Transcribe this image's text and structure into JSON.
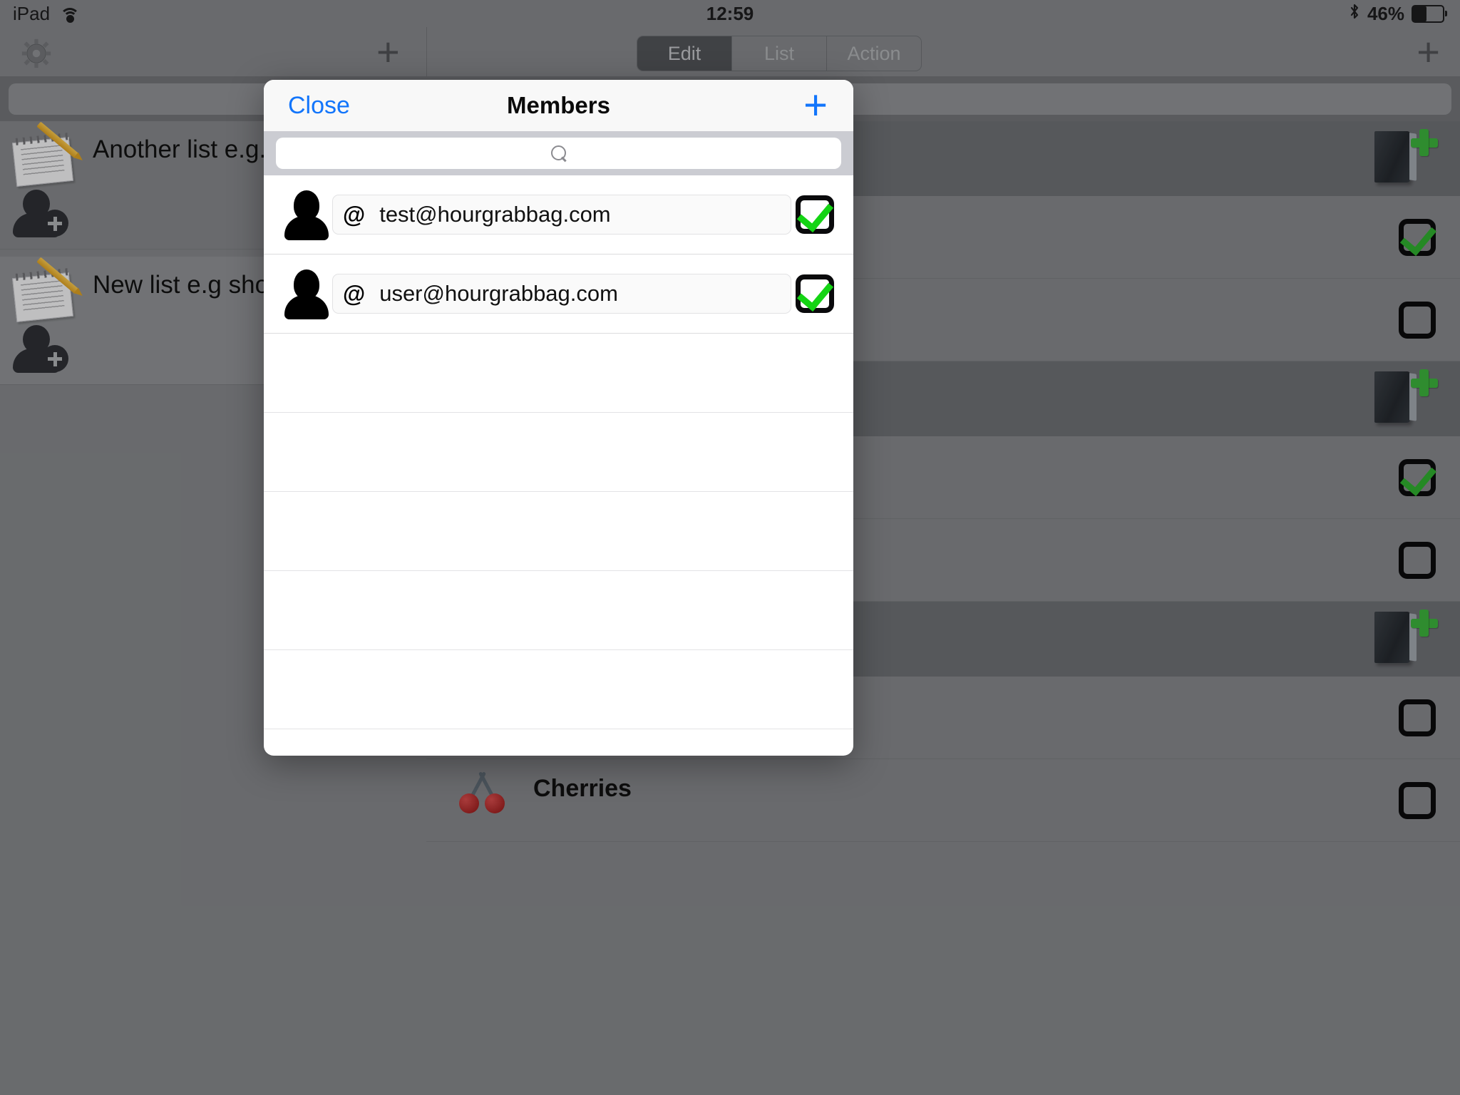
{
  "status_bar": {
    "device": "iPad",
    "wifi_icon": "wifi-icon",
    "time": "12:59",
    "bluetooth_icon": "bluetooth-icon",
    "battery_percent": "46%",
    "battery_level": 46
  },
  "left_pane": {
    "settings_icon": "gear-icon",
    "add_icon": "plus-icon",
    "search_placeholder": "",
    "search_value": "",
    "lists": [
      {
        "title": "Another list e.g. Work",
        "icon": "notepad-pencil-icon",
        "member_icon": "person-add-icon"
      },
      {
        "title": "New list e.g shopping list",
        "icon": "notepad-pencil-icon",
        "member_icon": "person-add-icon"
      }
    ]
  },
  "right_pane": {
    "segmented": {
      "options": [
        "Edit",
        "List",
        "Action"
      ],
      "selected": "Edit"
    },
    "add_icon": "plus-icon",
    "rows": [
      {
        "type": "book",
        "icon": "book-add-icon"
      },
      {
        "type": "check",
        "icon": "checkbox-checked-icon",
        "checked": true
      },
      {
        "type": "check",
        "icon": "checkbox-unchecked-icon",
        "checked": false
      },
      {
        "type": "book",
        "icon": "book-add-icon"
      },
      {
        "type": "check",
        "icon": "checkbox-checked-icon",
        "checked": true
      },
      {
        "type": "check",
        "icon": "checkbox-unchecked-icon",
        "checked": false
      },
      {
        "type": "book",
        "icon": "book-add-icon"
      },
      {
        "type": "check",
        "icon": "checkbox-unchecked-icon",
        "checked": false
      }
    ],
    "bottom_item": {
      "title": "Cherries",
      "icon": "cherries-icon"
    }
  },
  "modal": {
    "close_label": "Close",
    "title": "Members",
    "add_icon": "plus-icon",
    "search_value": "",
    "search_placeholder": "",
    "search_icon": "search-icon",
    "members": [
      {
        "avatar": "person-icon",
        "at_symbol": "@",
        "email": "test@hourgrabbag.com",
        "checked": true
      },
      {
        "avatar": "person-icon",
        "at_symbol": "@",
        "email": "user@hourgrabbag.com",
        "checked": true
      }
    ],
    "empty_row_count": 5
  },
  "colors": {
    "accent_blue": "#1275fb",
    "check_green": "#14d414",
    "chrome_gray": "#808285",
    "dark_gray": "#6a6c70"
  }
}
